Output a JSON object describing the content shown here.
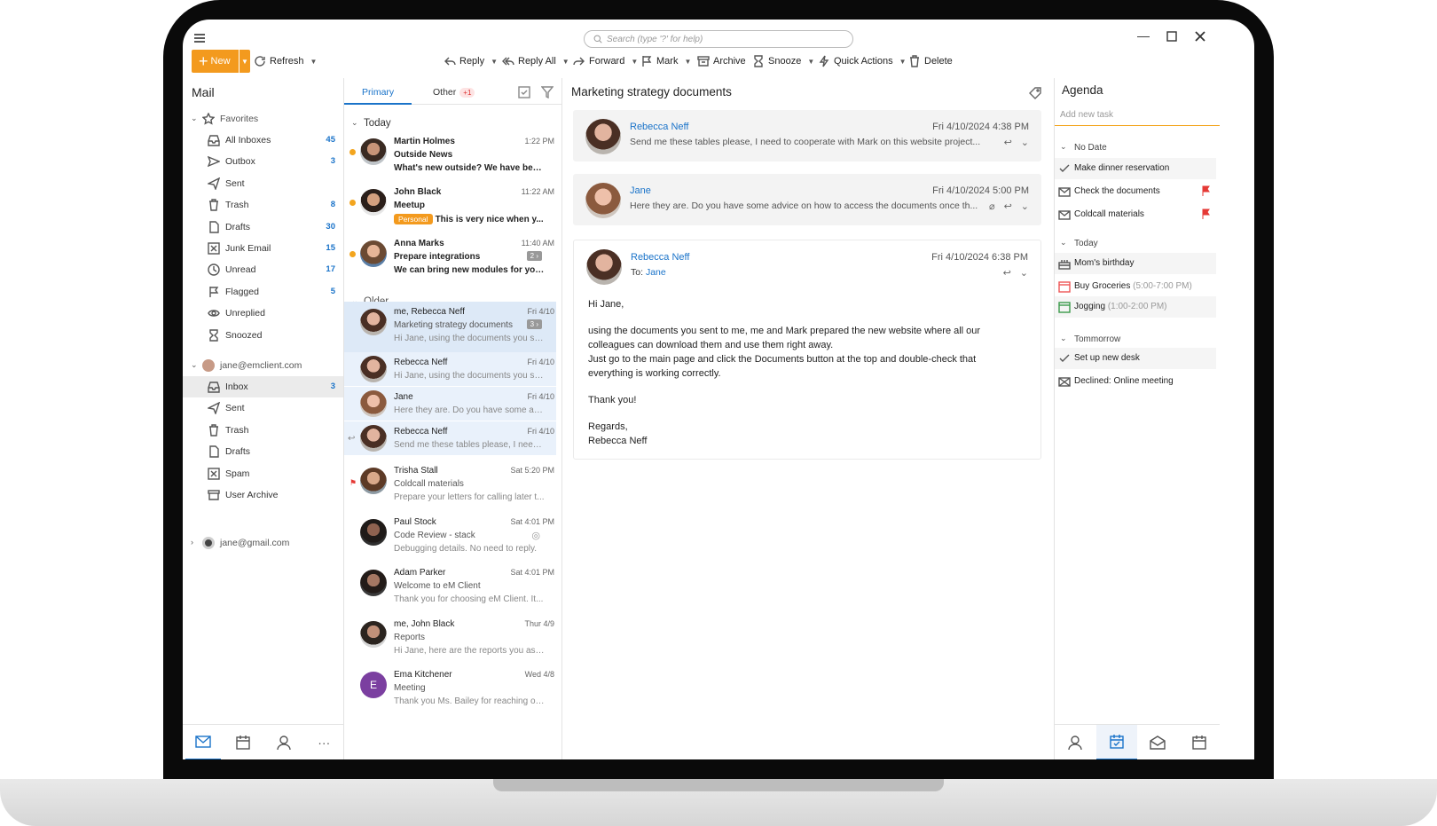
{
  "search": {
    "placeholder": "Search (type '?' for help)"
  },
  "toolbar": {
    "new_label": "New",
    "refresh_label": "Refresh",
    "reply_label": "Reply",
    "reply_all_label": "Reply All",
    "forward_label": "Forward",
    "mark_label": "Mark",
    "archive_label": "Archive",
    "snooze_label": "Snooze",
    "quick_actions_label": "Quick Actions",
    "delete_label": "Delete"
  },
  "sidebar": {
    "title": "Mail",
    "favorites_label": "Favorites",
    "favorites": [
      {
        "label": "All Inboxes",
        "count": "45"
      },
      {
        "label": "Outbox",
        "count": "3"
      },
      {
        "label": "Sent",
        "count": ""
      },
      {
        "label": "Trash",
        "count": "8"
      },
      {
        "label": "Drafts",
        "count": "30"
      },
      {
        "label": "Junk Email",
        "count": "15"
      },
      {
        "label": "Unread",
        "count": "17"
      },
      {
        "label": "Flagged",
        "count": "5"
      },
      {
        "label": "Unreplied",
        "count": ""
      },
      {
        "label": "Snoozed",
        "count": ""
      }
    ],
    "account1": "jane@emclient.com",
    "account1_folders": [
      {
        "label": "Inbox",
        "count": "3"
      },
      {
        "label": "Sent",
        "count": ""
      },
      {
        "label": "Trash",
        "count": ""
      },
      {
        "label": "Drafts",
        "count": ""
      },
      {
        "label": "Spam",
        "count": ""
      },
      {
        "label": "User Archive",
        "count": ""
      }
    ],
    "account2": "jane@gmail.com"
  },
  "list": {
    "tab_primary": "Primary",
    "tab_other": "Other",
    "tab_other_badge": "+1",
    "group_today": "Today",
    "group_older": "Older",
    "messages": [
      {
        "from": "Martin Holmes",
        "time": "1:22 PM",
        "subject": "Outside News",
        "preview": "What's new outside? We have been...",
        "tag": "",
        "thread": ""
      },
      {
        "from": "John Black",
        "time": "11:22 AM",
        "subject": "Meetup",
        "preview": "This is very nice when y...",
        "tag": "Personal",
        "thread": ""
      },
      {
        "from": "Anna Marks",
        "time": "11:40 AM",
        "subject": "Prepare integrations",
        "preview": "We can bring new modules for you...",
        "tag": "",
        "thread": "2 ›"
      },
      {
        "from": "me, Rebecca Neff",
        "time": "Fri 4/10",
        "subject": "Marketing strategy documents",
        "preview": "Hi Jane, using the documents you se...",
        "tag": "",
        "thread": "3 ›"
      },
      {
        "from": "Rebecca Neff",
        "time": "Fri 4/10",
        "subject": "",
        "preview": "Hi Jane, using the documents you se...",
        "tag": "",
        "thread": ""
      },
      {
        "from": "Jane",
        "time": "Fri 4/10",
        "subject": "",
        "preview": "Here they are. Do you have some adv...",
        "tag": "",
        "thread": ""
      },
      {
        "from": "Rebecca Neff",
        "time": "Fri 4/10",
        "subject": "",
        "preview": "Send me these tables please, I need t...",
        "tag": "",
        "thread": ""
      },
      {
        "from": "Trisha Stall",
        "time": "Sat 5:20 PM",
        "subject": "Coldcall materials",
        "preview": "Prepare your letters for calling later t...",
        "tag": "",
        "thread": ""
      },
      {
        "from": "Paul Stock",
        "time": "Sat 4:01 PM",
        "subject": "Code Review - stack",
        "preview": "Debugging details. No need to reply.",
        "tag": "",
        "thread": ""
      },
      {
        "from": "Adam Parker",
        "time": "Sat 4:01 PM",
        "subject": "Welcome to eM Client",
        "preview": "Thank you for choosing eM Client. It...",
        "tag": "",
        "thread": ""
      },
      {
        "from": "me, John Black",
        "time": "Thur 4/9",
        "subject": "Reports",
        "preview": "Hi Jane, here are the reports you ask...",
        "tag": "",
        "thread": ""
      },
      {
        "from": "Ema Kitchener",
        "time": "Wed 4/8",
        "subject": "Meeting",
        "preview": "Thank you Ms. Bailey for reaching ou...",
        "tag": "",
        "thread": "",
        "initial": "E"
      }
    ]
  },
  "reader": {
    "title": "Marketing strategy documents",
    "cards": [
      {
        "from": "Rebecca Neff",
        "date": "Fri 4/10/2024 4:38 PM",
        "preview": "Send me these tables please, I need to cooperate with Mark on this website project..."
      },
      {
        "from": "Jane",
        "date": "Fri 4/10/2024 5:00 PM",
        "preview": "Here they are. Do you have some advice on how to access the documents once th..."
      },
      {
        "from": "Rebecca Neff",
        "date": "Fri 4/10/2024 6:38 PM",
        "to_label": "To:",
        "to": "Jane"
      }
    ],
    "body": {
      "greeting": "Hi Jane,",
      "p1": "using the documents you sent to me, me and Mark prepared the new website where all our colleagues can download them and use them right away.",
      "p2": "Just go to the main page and click the Documents button at the top and double-check that everything is working correctly.",
      "thanks": "Thank you!",
      "regards": "Regards,",
      "signature": "Rebecca Neff"
    }
  },
  "agenda": {
    "title": "Agenda",
    "add_task_placeholder": "Add new task",
    "group_nodate": "No Date",
    "group_today": "Today",
    "group_tomorrow": "Tommorrow",
    "nodate_items": [
      {
        "label": "Make dinner reservation",
        "extra": ""
      },
      {
        "label": "Check the documents",
        "extra": ""
      },
      {
        "label": "Coldcall materials",
        "extra": ""
      }
    ],
    "today_items": [
      {
        "label": "Mom's birthday",
        "extra": ""
      },
      {
        "label": "Buy Groceries",
        "extra": "(5:00-7:00 PM)"
      },
      {
        "label": "Jogging",
        "extra": "(1:00-2:00 PM)"
      }
    ],
    "tomorrow_items": [
      {
        "label": "Set up new desk",
        "extra": ""
      },
      {
        "label": "Declined: Online meeting",
        "extra": ""
      }
    ]
  },
  "colors": {
    "accent": "#1a73c9",
    "new_button": "#f39a1e",
    "flag": "#e53935"
  }
}
